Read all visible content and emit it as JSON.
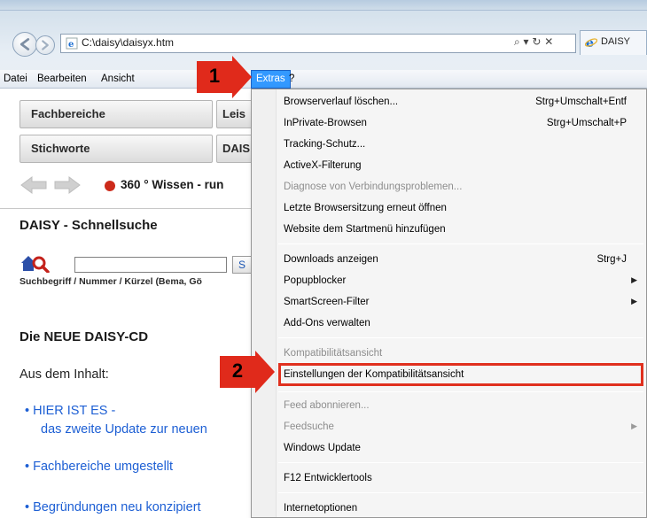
{
  "window": {
    "address": "C:\\daisy\\daisyx.htm",
    "address_actions": "⌕ ▾ ↻ ✕",
    "tab_label": "DAISY"
  },
  "menubar": {
    "items": [
      "Datei",
      "Bearbeiten",
      "Ansicht",
      "Extras",
      "?"
    ]
  },
  "page": {
    "buttons": [
      "Fachbereiche",
      "Leis",
      "Stichworte",
      "DAIS"
    ],
    "ticker": "360 ° Wissen - run",
    "quicksearch_title": "DAISY - Schnellsuche",
    "search_button": "S",
    "search_hint": "Suchbegriff / Nummer / Kürzel (Bema, Gö",
    "cd_title": "Die NEUE DAISY-CD",
    "cd_subtitle": "Aus dem Inhalt:",
    "bullets": [
      "• HIER IST ES -",
      "das zweite Update zur neuen",
      "• Fachbereiche umgestellt",
      "• Begründungen neu konzipiert"
    ]
  },
  "extras_menu": {
    "items": [
      {
        "label": "Browserverlauf löschen...",
        "shortcut": "Strg+Umschalt+Entf"
      },
      {
        "label": "InPrivate-Browsen",
        "shortcut": "Strg+Umschalt+P"
      },
      {
        "label": "Tracking-Schutz..."
      },
      {
        "label": "ActiveX-Filterung"
      },
      {
        "label": "Diagnose von Verbindungsproblemen...",
        "disabled": true
      },
      {
        "label": "Letzte Browsersitzung erneut öffnen"
      },
      {
        "label": "Website dem Startmenü hinzufügen"
      },
      {
        "label": "Downloads anzeigen",
        "shortcut": "Strg+J"
      },
      {
        "label": "Popupblocker"
      },
      {
        "label": "SmartScreen-Filter"
      },
      {
        "label": "Add-Ons verwalten"
      },
      {
        "label": "Kompatibilitätsansicht",
        "disabled": true
      },
      {
        "label": "Einstellungen der Kompatibilitätsansicht",
        "highlighted": true
      },
      {
        "label": "Feed abonnieren...",
        "disabled": true
      },
      {
        "label": "Feedsuche",
        "disabled": true
      },
      {
        "label": "Windows Update"
      },
      {
        "label": "F12 Entwicklertools"
      },
      {
        "label": "Internetoptionen"
      }
    ]
  },
  "callouts": [
    "1",
    "2"
  ],
  "colors": {
    "menu_active": "#3399ff",
    "callout_red": "#e02a1b",
    "link_blue": "#1d5fd4"
  }
}
